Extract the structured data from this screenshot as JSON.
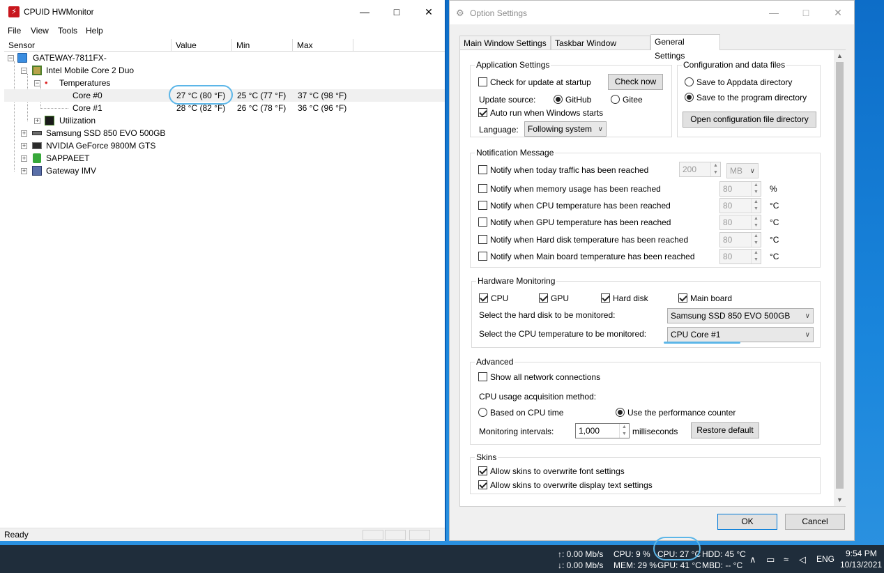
{
  "hwmonitor": {
    "title": "CPUID HWMonitor",
    "menu": [
      "File",
      "View",
      "Tools",
      "Help"
    ],
    "columns": [
      "Sensor",
      "Value",
      "Min",
      "Max"
    ],
    "tree": {
      "root": "GATEWAY-7811FX-",
      "cpu": "Intel Mobile Core 2 Duo",
      "temperatures": "Temperatures",
      "core0": {
        "name": "Core #0",
        "value": "27 °C  (80 °F)",
        "min": "25 °C  (77 °F)",
        "max": "37 °C  (98 °F)"
      },
      "core1": {
        "name": "Core #1",
        "value": "28 °C  (82 °F)",
        "min": "26 °C  (78 °F)",
        "max": "36 °C  (96 °F)"
      },
      "utilization": "Utilization",
      "ssd": "Samsung SSD 850 EVO 500GB",
      "gpu": "NVIDIA GeForce 9800M GTS",
      "sappaeet": "SAPPAEET",
      "imv": "Gateway IMV"
    },
    "status": "Ready"
  },
  "options": {
    "title": "Option Settings",
    "tabs": [
      "Main Window Settings",
      "Taskbar Window Settings",
      "General Settings"
    ],
    "app_settings": {
      "title": "Application Settings",
      "check_update": "Check for update at startup",
      "check_now": "Check now",
      "update_source": "Update source:",
      "github": "GitHub",
      "gitee": "Gitee",
      "auto_run": "Auto run when Windows starts",
      "language": "Language:",
      "language_value": "Following system"
    },
    "config": {
      "title": "Configuration and data files",
      "appdata": "Save to Appdata directory",
      "program_dir": "Save to the program directory",
      "open_dir": "Open configuration file directory"
    },
    "notification": {
      "title": "Notification Message",
      "traffic": "Notify when today traffic has been reached",
      "traffic_value": "200",
      "traffic_unit": "MB",
      "memory": "Notify when memory usage has been reached",
      "cpu": "Notify when CPU temperature has been reached",
      "gpu": "Notify when GPU temperature has been reached",
      "hdd": "Notify when Hard disk temperature has been reached",
      "mainboard": "Notify when Main board temperature has been reached",
      "threshold": "80",
      "pct": "%",
      "deg": "°C"
    },
    "hardware": {
      "title": "Hardware Monitoring",
      "cpu": "CPU",
      "gpu": "GPU",
      "hdd": "Hard disk",
      "mainboard": "Main board",
      "select_hdd": "Select the hard disk to be monitored:",
      "hdd_value": "Samsung SSD 850 EVO 500GB",
      "select_cpu": "Select the CPU temperature to be monitored:",
      "cpu_value": "CPU Core #1"
    },
    "advanced": {
      "title": "Advanced",
      "show_all": "Show all network connections",
      "cpu_method": "CPU usage acquisition method:",
      "cpu_time": "Based on CPU time",
      "perf_counter": "Use the performance counter",
      "intervals": "Monitoring intervals:",
      "interval_value": "1,000",
      "ms": "milliseconds",
      "restore": "Restore default"
    },
    "skins": {
      "title": "Skins",
      "font": "Allow skins to overwrite font settings",
      "display": "Allow skins to overwrite display text settings"
    },
    "ok": "OK",
    "cancel": "Cancel"
  },
  "taskbar": {
    "up": "↑: 0.00 Mb/s",
    "down": "↓: 0.00 Mb/s",
    "cpu": "CPU: 9 %",
    "mem": "MEM: 29 %",
    "cpu_temp": "CPU: 27 °C",
    "gpu_temp": "GPU: 41 °C",
    "hdd": "HDD: 45 °C",
    "mbd": "MBD: -- °C",
    "lang": "ENG",
    "time": "9:54 PM",
    "date": "10/13/2021"
  }
}
